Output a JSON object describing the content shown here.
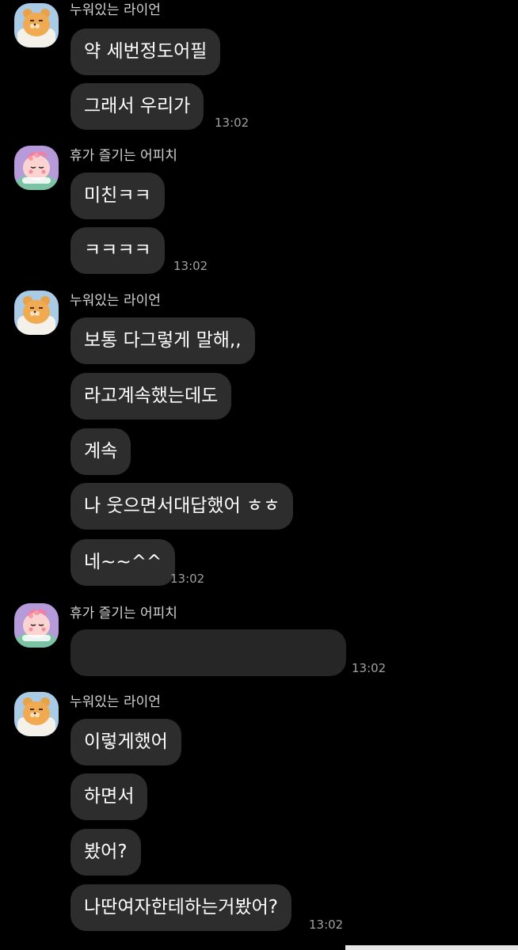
{
  "chat": {
    "groups": [
      {
        "sender": "누워있는 라이언",
        "avatar_icon": "ryan-lying-icon",
        "messages": [
          "약 세번정도어필",
          "그래서 우리가"
        ],
        "time": "13:02"
      },
      {
        "sender": "휴가 즐기는 어피치",
        "avatar_icon": "apeach-vacation-icon",
        "messages": [
          "미친ㅋㅋ",
          "ㅋㅋㅋㅋ"
        ],
        "time": "13:02"
      },
      {
        "sender": "누워있는 라이언",
        "avatar_icon": "ryan-lying-icon",
        "messages": [
          "보통 다그렇게 말해,,",
          "라고계속했는데도",
          "계속",
          "나 웃으면서대답했어 ㅎㅎ",
          "네~~^^"
        ],
        "time": "13:02"
      },
      {
        "sender": "휴가 즐기는 어피치",
        "avatar_icon": "apeach-vacation-icon",
        "messages": [
          ""
        ],
        "time": "13:02"
      },
      {
        "sender": "누워있는 라이언",
        "avatar_icon": "ryan-lying-icon",
        "messages": [
          "이렇게했어",
          "하면서",
          "봤어?",
          "나딴여자한테하는거봤어?"
        ],
        "time": "13:02"
      }
    ]
  },
  "colors": {
    "background": "#000000",
    "bubble": "#2d2d2d",
    "sender_text": "#d4d4d4",
    "time_text": "#a0a0a0",
    "ryan_avatar_bg": "#a9cbe6",
    "apeach_avatar_bg": "#b79ad9"
  }
}
